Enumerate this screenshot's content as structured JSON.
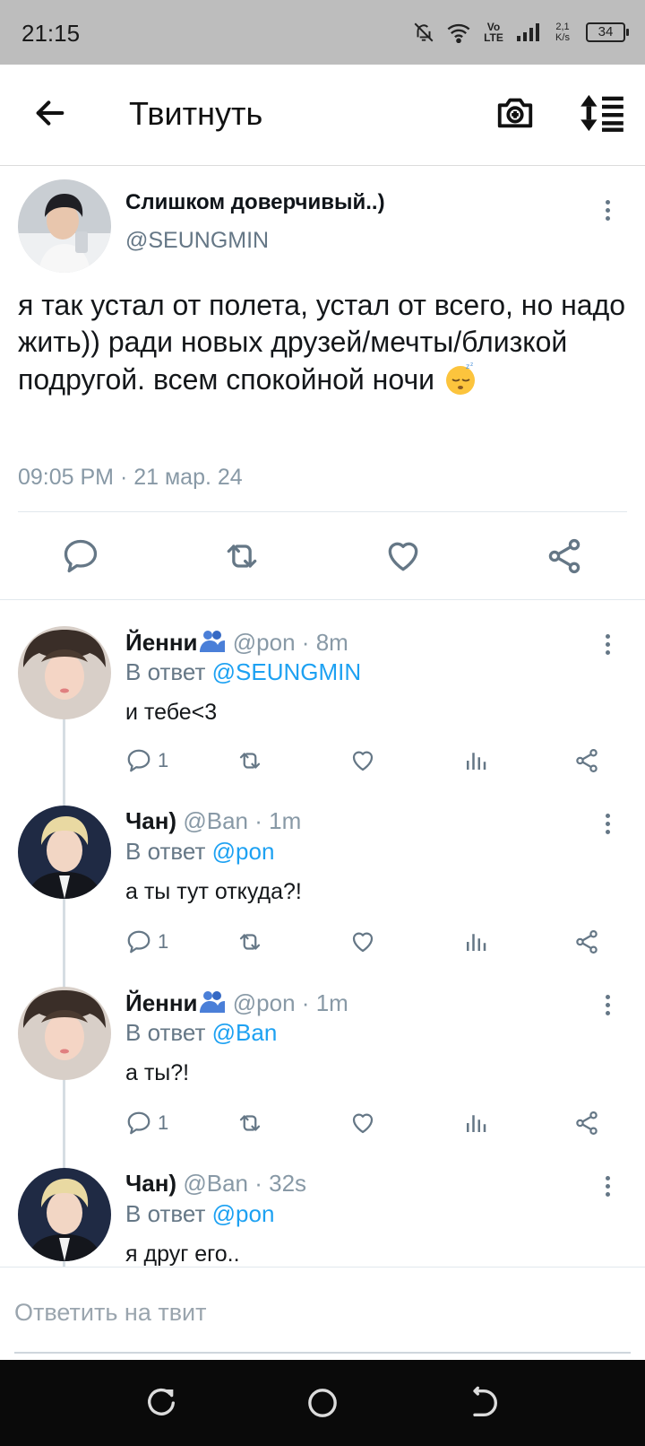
{
  "status_bar": {
    "time": "21:15",
    "network": "Vo LTE",
    "speed": "2,1 K/s",
    "battery": "34"
  },
  "header": {
    "title": "Твитнуть"
  },
  "main_tweet": {
    "name": "Слишком доверчивый..)",
    "handle": "@SEUNGMIN",
    "text": "я так устал от полета, устал от всего, но надо жить)) ради новых друзей/мечты/близкой подругой. всем спокойной ночи",
    "timestamp": "09:05 PM · 21 мар. 24"
  },
  "reply_prefix": "В ответ",
  "replies": [
    {
      "name": "Йенни",
      "handle": "@pon",
      "time": "8m",
      "reply_to": "@SEUNGMIN",
      "text": "и тебе<3",
      "reply_count": "1"
    },
    {
      "name": "Чан)",
      "handle": "@Ban",
      "time": "1m",
      "reply_to": "@pon",
      "text": "а ты тут откуда?!",
      "reply_count": "1"
    },
    {
      "name": "Йенни",
      "handle": "@pon",
      "time": "1m",
      "reply_to": "@Ban",
      "text": "а ты?!",
      "reply_count": "1"
    },
    {
      "name": "Чан)",
      "handle": "@Ban",
      "time": "32s",
      "reply_to": "@pon",
      "text": "я друг его..",
      "reply_count": ""
    }
  ],
  "reply_box": {
    "placeholder": "Ответить на твит"
  },
  "icons": {
    "back": "arrow-left-icon",
    "camera": "camera-plus-icon",
    "sort": "sort-icon",
    "reply": "comment-icon",
    "retweet": "retweet-icon",
    "like": "heart-icon",
    "stats": "stats-icon",
    "share": "share-icon",
    "more": "more-vertical-icon"
  },
  "colors": {
    "link": "#1da1f2",
    "secondary": "#657786",
    "status_bar": "#bdbdbd",
    "nav_bar": "#0a0a0a"
  }
}
